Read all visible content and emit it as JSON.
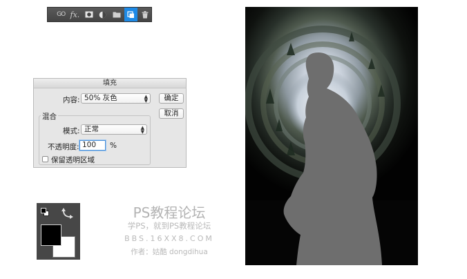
{
  "layers_toolbar": {
    "buttons": [
      {
        "name": "link",
        "icon": "link-icon",
        "label": "GO"
      },
      {
        "name": "fx",
        "icon": "fx-icon",
        "label": "fx."
      },
      {
        "name": "mask",
        "icon": "layer-mask-icon"
      },
      {
        "name": "adjustment",
        "icon": "adjustment-layer-icon"
      },
      {
        "name": "group",
        "icon": "folder-icon"
      },
      {
        "name": "new-layer",
        "icon": "new-layer-icon",
        "active": true
      },
      {
        "name": "delete",
        "icon": "trash-icon"
      }
    ],
    "active_color": "#1e8ae6"
  },
  "fill_dialog": {
    "title": "填充",
    "contents_label": "内容:",
    "contents_value": "50% 灰色",
    "ok_label": "确定",
    "cancel_label": "取消",
    "blending_group_label": "混合",
    "mode_label": "模式:",
    "mode_value": "正常",
    "opacity_label": "不透明度:",
    "opacity_value": "100",
    "opacity_unit": "%",
    "preserve_transparency_label": "保留透明区域",
    "preserve_transparency_checked": false
  },
  "color_swatches": {
    "foreground": "#000000",
    "background": "#ffffff",
    "default_colors_icon": "default-colors-icon",
    "swap_icon": "swap-colors-icon"
  },
  "watermark": {
    "title": "PS教程论坛",
    "subtitle": "学PS，就到PS教程论坛",
    "url": "BBS.16XX8.COM",
    "author": "作者：姑酷 dongdihua"
  },
  "photo": {
    "subject": "silhouette-of-person",
    "silhouette_color": "#6e6e6e"
  }
}
